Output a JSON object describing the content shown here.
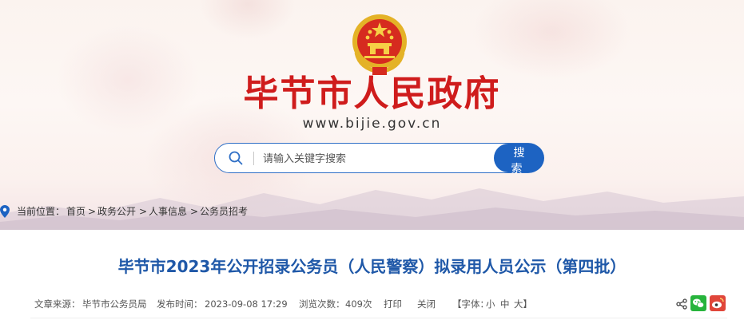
{
  "site": {
    "title": "毕节市人民政府",
    "url": "www.bijie.gov.cn"
  },
  "search": {
    "placeholder": "请输入关键字搜索",
    "button_label": "搜 索"
  },
  "breadcrumb": {
    "prefix": "当前位置：",
    "items": [
      "首页",
      "政务公开",
      "人事信息",
      "公务员招考"
    ],
    "separator": ">"
  },
  "article": {
    "title": "毕节市2023年公开招录公务员（人民警察）拟录用人员公示（第四批）",
    "source_label": "文章来源：",
    "source": "毕节市公务员局",
    "published_label": "发布时间：",
    "published": "2023-09-08 17:29",
    "views_label": "浏览次数：",
    "views": "409次",
    "print_label": "打印",
    "close_label": "关闭",
    "font_label": "【字体：",
    "font_small": "小",
    "font_medium": "中",
    "font_large": "大】"
  },
  "share": {
    "icons": [
      "share-icon",
      "wechat-icon",
      "weibo-icon"
    ]
  },
  "colors": {
    "brand_red": "#cf1c1c",
    "primary_blue": "#1d63c2",
    "title_blue": "#1f58a8",
    "wechat_green": "#27b43c",
    "weibo_red": "#e0463a"
  }
}
